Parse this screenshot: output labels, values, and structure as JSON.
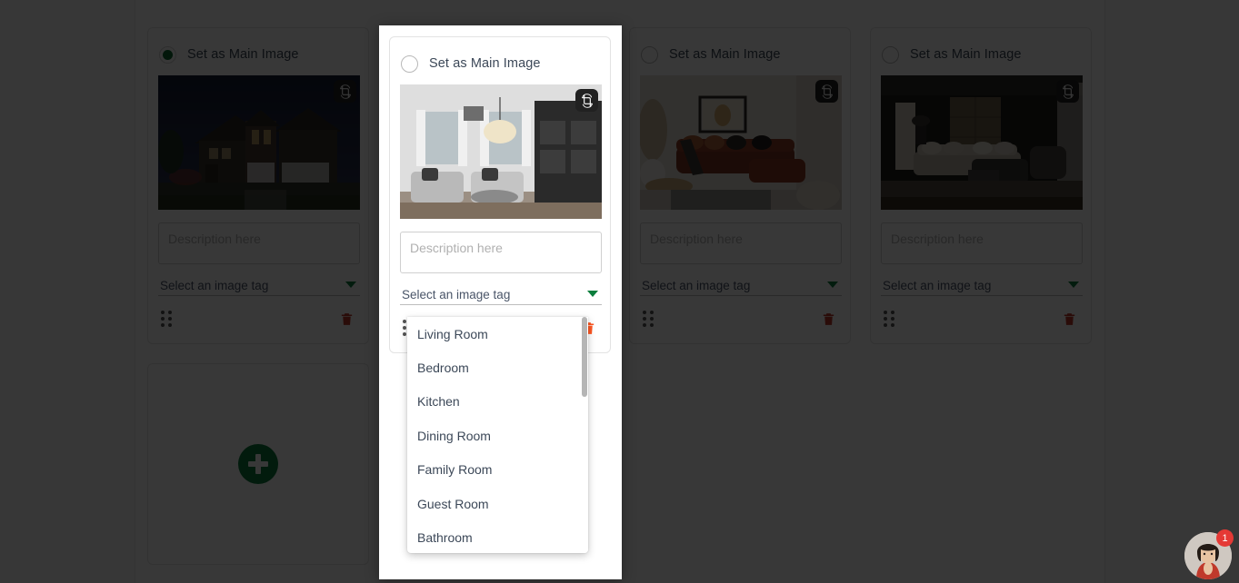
{
  "cards": [
    {
      "main_image_label": "Set as Main Image",
      "selected": true,
      "description_placeholder": "Description here",
      "description_value": "",
      "tag_placeholder": "Select an image tag",
      "image_alt": "suburban-house-exterior-dusk",
      "crop_icon": "crop-rotate-icon",
      "drag_icon": "drag-handle-icon",
      "delete_icon": "trash-icon"
    },
    {
      "main_image_label": "Set as Main Image",
      "selected": false,
      "description_placeholder": "Description here",
      "description_value": "",
      "tag_placeholder": "Select an image tag",
      "image_alt": "grey-living-room-interior",
      "crop_icon": "crop-rotate-icon",
      "drag_icon": "drag-handle-icon",
      "delete_icon": "trash-icon"
    },
    {
      "main_image_label": "Set as Main Image",
      "selected": false,
      "description_placeholder": "Description here",
      "description_value": "",
      "tag_placeholder": "Select an image tag",
      "image_alt": "warm-living-room-rust-sofa",
      "crop_icon": "crop-rotate-icon",
      "drag_icon": "drag-handle-icon",
      "delete_icon": "trash-icon"
    },
    {
      "main_image_label": "Set as Main Image",
      "selected": false,
      "description_placeholder": "Description here",
      "description_value": "",
      "tag_placeholder": "Select an image tag",
      "image_alt": "dark-modern-living-room",
      "crop_icon": "crop-rotate-icon",
      "drag_icon": "drag-handle-icon",
      "delete_icon": "trash-icon"
    }
  ],
  "add_card": {
    "icon": "plus-circle-icon",
    "label": ""
  },
  "modal": {
    "card_index": 1,
    "main_image_label": "Set as Main Image",
    "description_placeholder": "Description here",
    "tag_placeholder": "Select an image tag"
  },
  "dropdown": {
    "open": true,
    "options": [
      "Living Room",
      "Bedroom",
      "Kitchen",
      "Dining Room",
      "Family Room",
      "Guest Room",
      "Bathroom"
    ]
  },
  "chat_widget": {
    "badge_count": "1",
    "avatar_alt": "support-agent-avatar"
  },
  "colors": {
    "accent_green": "#0a7d3c",
    "selected_radio": "#0a6b2e",
    "delete_red": "#ff5722",
    "delete_red_dim": "#c0392b",
    "badge_red": "#e53935",
    "card_border": "#e3e3e3",
    "text": "#3c4858",
    "placeholder": "#b0b0b0"
  }
}
